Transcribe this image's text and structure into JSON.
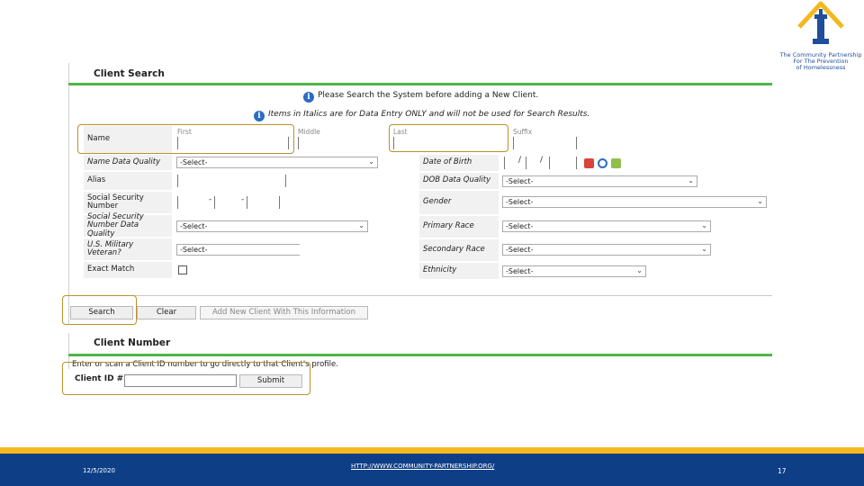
{
  "logo": {
    "lines": [
      "The Community Partnership",
      "For The Prevention",
      "of Homelessness"
    ],
    "colors": {
      "roof": "#f3b81f",
      "tower": "#1f4e9b"
    }
  },
  "client_search": {
    "title": "Client Search",
    "info1": "Please Search the System before adding a New Client.",
    "info2": "Items in Italics are for Data Entry ONLY and will not be used for Search Results.",
    "columns": {
      "first": "First",
      "middle": "Middle",
      "last": "Last",
      "suffix": "Suffix"
    },
    "left_fields": {
      "name": "Name",
      "name_quality": "Name Data Quality",
      "alias": "Alias",
      "ssn": "Social Security Number",
      "ssn_quality": "Social Security Number Data Quality",
      "veteran": "U.S. Military Veteran?",
      "exact_match": "Exact Match"
    },
    "right_fields": {
      "dob": "Date of Birth",
      "dob_quality": "DOB Data Quality",
      "gender": "Gender",
      "primary_race": "Primary Race",
      "secondary_race": "Secondary Race",
      "ethnicity": "Ethnicity"
    },
    "select_default": "-Select-",
    "dash": "-",
    "date_sep": "/",
    "buttons": {
      "search": "Search",
      "clear": "Clear",
      "add_new": "Add New Client With This Information"
    }
  },
  "client_number": {
    "title": "Client Number",
    "instruction": "Enter or scan a Client ID number to go directly to that Client's profile.",
    "label": "Client ID #",
    "submit": "Submit"
  },
  "footer": {
    "date": "12/5/2020",
    "url": "HTTP://WWW.COMMUNITY-PARTNERSHIP.ORG/",
    "page": "17"
  },
  "colors": {
    "accent_green": "#4fb548",
    "highlight": "#b8932a",
    "footer_blue": "#0e3f86",
    "footer_gold": "#f3b81f"
  }
}
